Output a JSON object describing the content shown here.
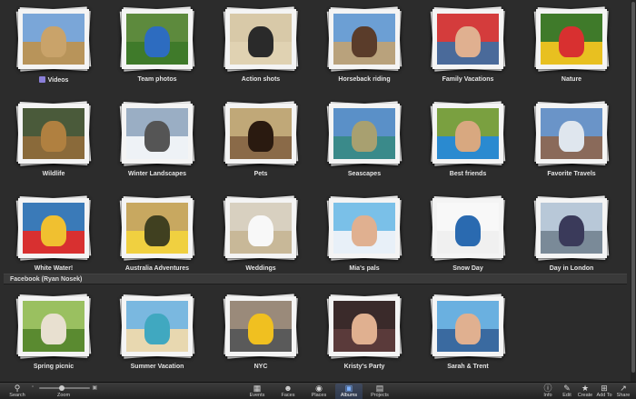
{
  "albums": [
    {
      "label": "Videos",
      "video": true,
      "sky": "#7aa6d8",
      "ground": "#b8945a",
      "subject": "#c9a36a"
    },
    {
      "label": "Team photos",
      "sky": "#5d8a3d",
      "ground": "#3f7a2a",
      "subject": "#2d6cc0"
    },
    {
      "label": "Action shots",
      "sky": "#d8c9a8",
      "ground": "#e0d2b2",
      "subject": "#2a2a2a"
    },
    {
      "label": "Horseback riding",
      "sky": "#6c9fd4",
      "ground": "#b9a27c",
      "subject": "#5a3c2a"
    },
    {
      "label": "Family Vacations",
      "sky": "#d43c3c",
      "ground": "#4a6a9a",
      "subject": "#e0b090"
    },
    {
      "label": "Nature",
      "sky": "#3f7a2a",
      "ground": "#e8c020",
      "subject": "#d83030"
    },
    {
      "label": "Wildlife",
      "sky": "#4a5a3a",
      "ground": "#8a6a3a",
      "subject": "#b08040"
    },
    {
      "label": "Winter Landscapes",
      "sky": "#9aaec4",
      "ground": "#eef2f6",
      "subject": "#555555"
    },
    {
      "label": "Pets",
      "sky": "#c0a878",
      "ground": "#8a6a48",
      "subject": "#2a1a10"
    },
    {
      "label": "Seascapes",
      "sky": "#5a90c8",
      "ground": "#3a8a8a",
      "subject": "#a8a070"
    },
    {
      "label": "Best friends",
      "sky": "#7aa040",
      "ground": "#2a8ad0",
      "subject": "#d8a880"
    },
    {
      "label": "Favorite Travels",
      "sky": "#6a94c8",
      "ground": "#8a6a5a",
      "subject": "#dfe6ee"
    },
    {
      "label": "White Water!",
      "sky": "#3a7ab8",
      "ground": "#d83030",
      "subject": "#f0c030"
    },
    {
      "label": "Australia Adventures",
      "sky": "#c8a860",
      "ground": "#f0d040",
      "subject": "#404020"
    },
    {
      "label": "Weddings",
      "sky": "#d8d0c0",
      "ground": "#c8b898",
      "subject": "#f8f8f8"
    },
    {
      "label": "Mia's pals",
      "sky": "#7ac0e8",
      "ground": "#e8f0f8",
      "subject": "#e0b090"
    },
    {
      "label": "Snow Day",
      "sky": "#f8f8f8",
      "ground": "#f0f0f0",
      "subject": "#2a6ab0"
    },
    {
      "label": "Day in London",
      "sky": "#b8c8d8",
      "ground": "#7a8a98",
      "subject": "#3a3a5a"
    },
    {
      "label": "Spring picnic",
      "sky": "#9ac060",
      "ground": "#5a8a30",
      "subject": "#e8e0d0"
    },
    {
      "label": "Summer Vacation",
      "sky": "#7ab8e0",
      "ground": "#e8d8b0",
      "subject": "#40a8c0"
    },
    {
      "label": "NYC",
      "sky": "#9a8a7a",
      "ground": "#5a5a5a",
      "subject": "#f0c020"
    },
    {
      "label": "Kristy's Party",
      "sky": "#3a2a2a",
      "ground": "#5a3a3a",
      "subject": "#e0b090"
    },
    {
      "label": "Sarah & Trent",
      "sky": "#6ab0e0",
      "ground": "#3a6aa0",
      "subject": "#e0b090"
    }
  ],
  "section": {
    "title": "Facebook (Ryan Nosek)"
  },
  "toolbar": {
    "search": "Search",
    "zoom": "Zoom",
    "events": "Events",
    "faces": "Faces",
    "places": "Places",
    "albums": "Albums",
    "projects": "Projects",
    "info": "Info",
    "edit": "Edit",
    "create": "Create",
    "add_to": "Add To",
    "share": "Share"
  },
  "zoom_level": 0.45,
  "accent_color": "#7fb3ff"
}
